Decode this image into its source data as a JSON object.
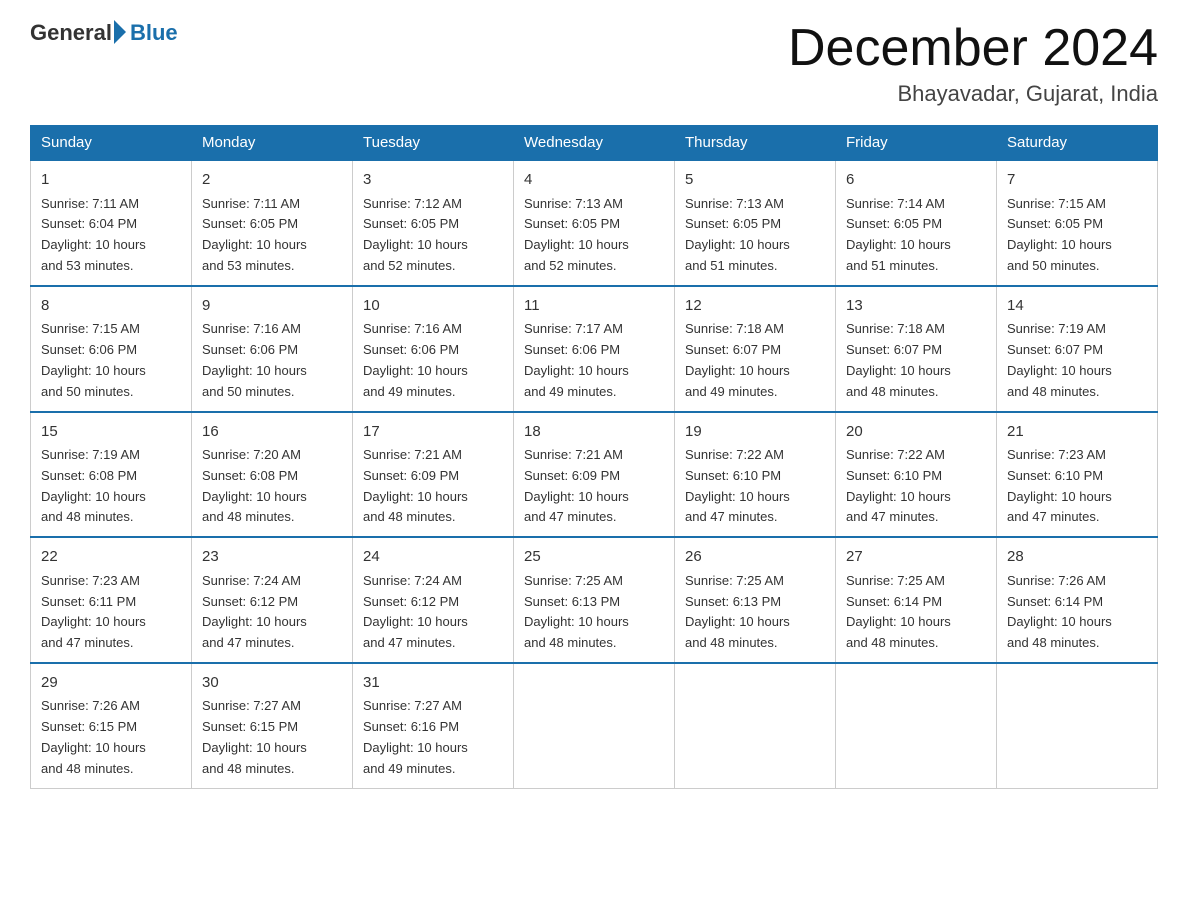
{
  "header": {
    "logo_general": "General",
    "logo_blue": "Blue",
    "month_title": "December 2024",
    "location": "Bhayavadar, Gujarat, India"
  },
  "days_of_week": [
    "Sunday",
    "Monday",
    "Tuesday",
    "Wednesday",
    "Thursday",
    "Friday",
    "Saturday"
  ],
  "weeks": [
    [
      {
        "num": "1",
        "sunrise": "7:11 AM",
        "sunset": "6:04 PM",
        "daylight": "10 hours and 53 minutes."
      },
      {
        "num": "2",
        "sunrise": "7:11 AM",
        "sunset": "6:05 PM",
        "daylight": "10 hours and 53 minutes."
      },
      {
        "num": "3",
        "sunrise": "7:12 AM",
        "sunset": "6:05 PM",
        "daylight": "10 hours and 52 minutes."
      },
      {
        "num": "4",
        "sunrise": "7:13 AM",
        "sunset": "6:05 PM",
        "daylight": "10 hours and 52 minutes."
      },
      {
        "num": "5",
        "sunrise": "7:13 AM",
        "sunset": "6:05 PM",
        "daylight": "10 hours and 51 minutes."
      },
      {
        "num": "6",
        "sunrise": "7:14 AM",
        "sunset": "6:05 PM",
        "daylight": "10 hours and 51 minutes."
      },
      {
        "num": "7",
        "sunrise": "7:15 AM",
        "sunset": "6:05 PM",
        "daylight": "10 hours and 50 minutes."
      }
    ],
    [
      {
        "num": "8",
        "sunrise": "7:15 AM",
        "sunset": "6:06 PM",
        "daylight": "10 hours and 50 minutes."
      },
      {
        "num": "9",
        "sunrise": "7:16 AM",
        "sunset": "6:06 PM",
        "daylight": "10 hours and 50 minutes."
      },
      {
        "num": "10",
        "sunrise": "7:16 AM",
        "sunset": "6:06 PM",
        "daylight": "10 hours and 49 minutes."
      },
      {
        "num": "11",
        "sunrise": "7:17 AM",
        "sunset": "6:06 PM",
        "daylight": "10 hours and 49 minutes."
      },
      {
        "num": "12",
        "sunrise": "7:18 AM",
        "sunset": "6:07 PM",
        "daylight": "10 hours and 49 minutes."
      },
      {
        "num": "13",
        "sunrise": "7:18 AM",
        "sunset": "6:07 PM",
        "daylight": "10 hours and 48 minutes."
      },
      {
        "num": "14",
        "sunrise": "7:19 AM",
        "sunset": "6:07 PM",
        "daylight": "10 hours and 48 minutes."
      }
    ],
    [
      {
        "num": "15",
        "sunrise": "7:19 AM",
        "sunset": "6:08 PM",
        "daylight": "10 hours and 48 minutes."
      },
      {
        "num": "16",
        "sunrise": "7:20 AM",
        "sunset": "6:08 PM",
        "daylight": "10 hours and 48 minutes."
      },
      {
        "num": "17",
        "sunrise": "7:21 AM",
        "sunset": "6:09 PM",
        "daylight": "10 hours and 48 minutes."
      },
      {
        "num": "18",
        "sunrise": "7:21 AM",
        "sunset": "6:09 PM",
        "daylight": "10 hours and 47 minutes."
      },
      {
        "num": "19",
        "sunrise": "7:22 AM",
        "sunset": "6:10 PM",
        "daylight": "10 hours and 47 minutes."
      },
      {
        "num": "20",
        "sunrise": "7:22 AM",
        "sunset": "6:10 PM",
        "daylight": "10 hours and 47 minutes."
      },
      {
        "num": "21",
        "sunrise": "7:23 AM",
        "sunset": "6:10 PM",
        "daylight": "10 hours and 47 minutes."
      }
    ],
    [
      {
        "num": "22",
        "sunrise": "7:23 AM",
        "sunset": "6:11 PM",
        "daylight": "10 hours and 47 minutes."
      },
      {
        "num": "23",
        "sunrise": "7:24 AM",
        "sunset": "6:12 PM",
        "daylight": "10 hours and 47 minutes."
      },
      {
        "num": "24",
        "sunrise": "7:24 AM",
        "sunset": "6:12 PM",
        "daylight": "10 hours and 47 minutes."
      },
      {
        "num": "25",
        "sunrise": "7:25 AM",
        "sunset": "6:13 PM",
        "daylight": "10 hours and 48 minutes."
      },
      {
        "num": "26",
        "sunrise": "7:25 AM",
        "sunset": "6:13 PM",
        "daylight": "10 hours and 48 minutes."
      },
      {
        "num": "27",
        "sunrise": "7:25 AM",
        "sunset": "6:14 PM",
        "daylight": "10 hours and 48 minutes."
      },
      {
        "num": "28",
        "sunrise": "7:26 AM",
        "sunset": "6:14 PM",
        "daylight": "10 hours and 48 minutes."
      }
    ],
    [
      {
        "num": "29",
        "sunrise": "7:26 AM",
        "sunset": "6:15 PM",
        "daylight": "10 hours and 48 minutes."
      },
      {
        "num": "30",
        "sunrise": "7:27 AM",
        "sunset": "6:15 PM",
        "daylight": "10 hours and 48 minutes."
      },
      {
        "num": "31",
        "sunrise": "7:27 AM",
        "sunset": "6:16 PM",
        "daylight": "10 hours and 49 minutes."
      },
      null,
      null,
      null,
      null
    ]
  ],
  "labels": {
    "sunrise": "Sunrise:",
    "sunset": "Sunset:",
    "daylight": "Daylight:"
  }
}
